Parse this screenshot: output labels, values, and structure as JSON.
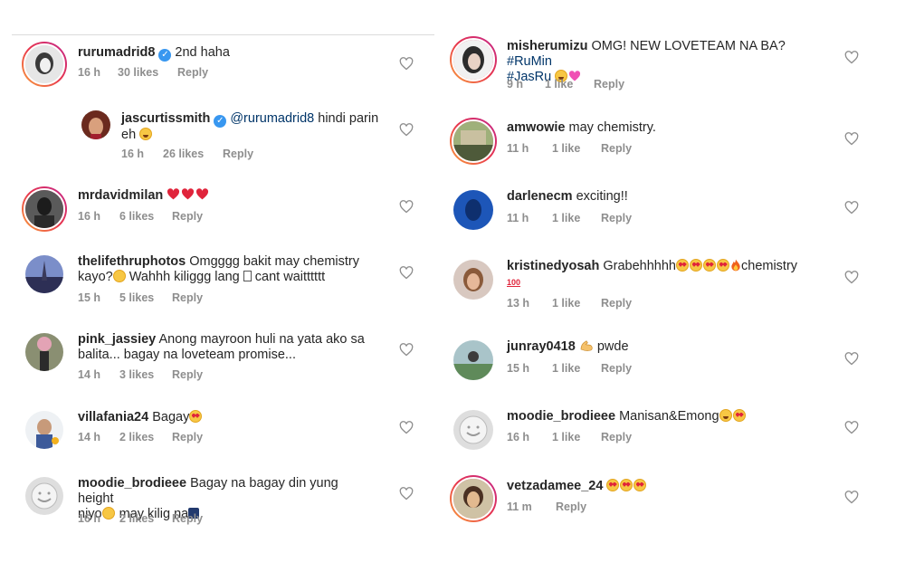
{
  "comments": [
    {
      "user": "rurumadrid8",
      "verified": true,
      "text": "2nd haha",
      "time": "16 h",
      "likes": "30 likes",
      "reply": "Reply"
    },
    {
      "user": "jascurtissmith",
      "verified": true,
      "mention": "@rurumadrid8",
      "text": "hindi parin",
      "text2": "eh",
      "time": "16 h",
      "likes": "26 likes",
      "reply": "Reply"
    },
    {
      "user": "mrdavidmilan",
      "time": "16 h",
      "likes": "6 likes",
      "reply": "Reply"
    },
    {
      "user": "thelifethruphotos",
      "text": "Omgggg bakit may chemistry",
      "text2a": "kayo?",
      "text2b": "Wahhh kiliggg lang",
      "text2c": "cant waitttttt",
      "time": "15 h",
      "likes": "5 likes",
      "reply": "Reply"
    },
    {
      "user": "pink_jassiey",
      "text": "Anong mayroon huli na  yata ako  sa",
      "text2": "balita... bagay na loveteam promise...",
      "time": "14 h",
      "likes": "3 likes",
      "reply": "Reply"
    },
    {
      "user": "villafania24",
      "text": "Bagay",
      "time": "14 h",
      "likes": "2 likes",
      "reply": "Reply"
    },
    {
      "user": "moodie_brodieee",
      "text": "Bagay na bagay din yung height",
      "text2a": "niyo",
      "text2b": "may kilig na",
      "time": "16 h",
      "likes": "2 likes",
      "reply": "Reply"
    },
    {
      "user": "misherumizu",
      "text": "OMG! NEW LOVETEAM NA BA?",
      "tag1": "#RuMin",
      "tag2": "#JasRu",
      "time": "9 h",
      "likes": "1 like",
      "reply": "Reply"
    },
    {
      "user": "amwowie",
      "text": "may chemistry.",
      "time": "11 h",
      "likes": "1 like",
      "reply": "Reply"
    },
    {
      "user": "darlenecm",
      "text": "exciting!!",
      "time": "11 h",
      "likes": "1 like",
      "reply": "Reply"
    },
    {
      "user": "kristinedyosah",
      "text": "Grabehhhhh",
      "text2": "chemistry",
      "time": "13 h",
      "likes": "1 like",
      "reply": "Reply"
    },
    {
      "user": "junray0418",
      "text": "pwde",
      "time": "15 h",
      "likes": "1 like",
      "reply": "Reply"
    },
    {
      "user": "moodie_brodieee",
      "text": "Manisan&Emong",
      "time": "16 h",
      "likes": "1 like",
      "reply": "Reply"
    },
    {
      "user": "vetzadamee_24",
      "time": "11 m",
      "likes": "",
      "reply": "Reply"
    }
  ],
  "colors": {
    "ring_start": "#f9a23b",
    "ring_end": "#c2268c",
    "verified": "#3897f0",
    "meta": "#8e8e8e",
    "hashtag": "#003569"
  },
  "icons": {
    "like": "heart-outline-icon",
    "verified": "verified-badge-icon"
  }
}
